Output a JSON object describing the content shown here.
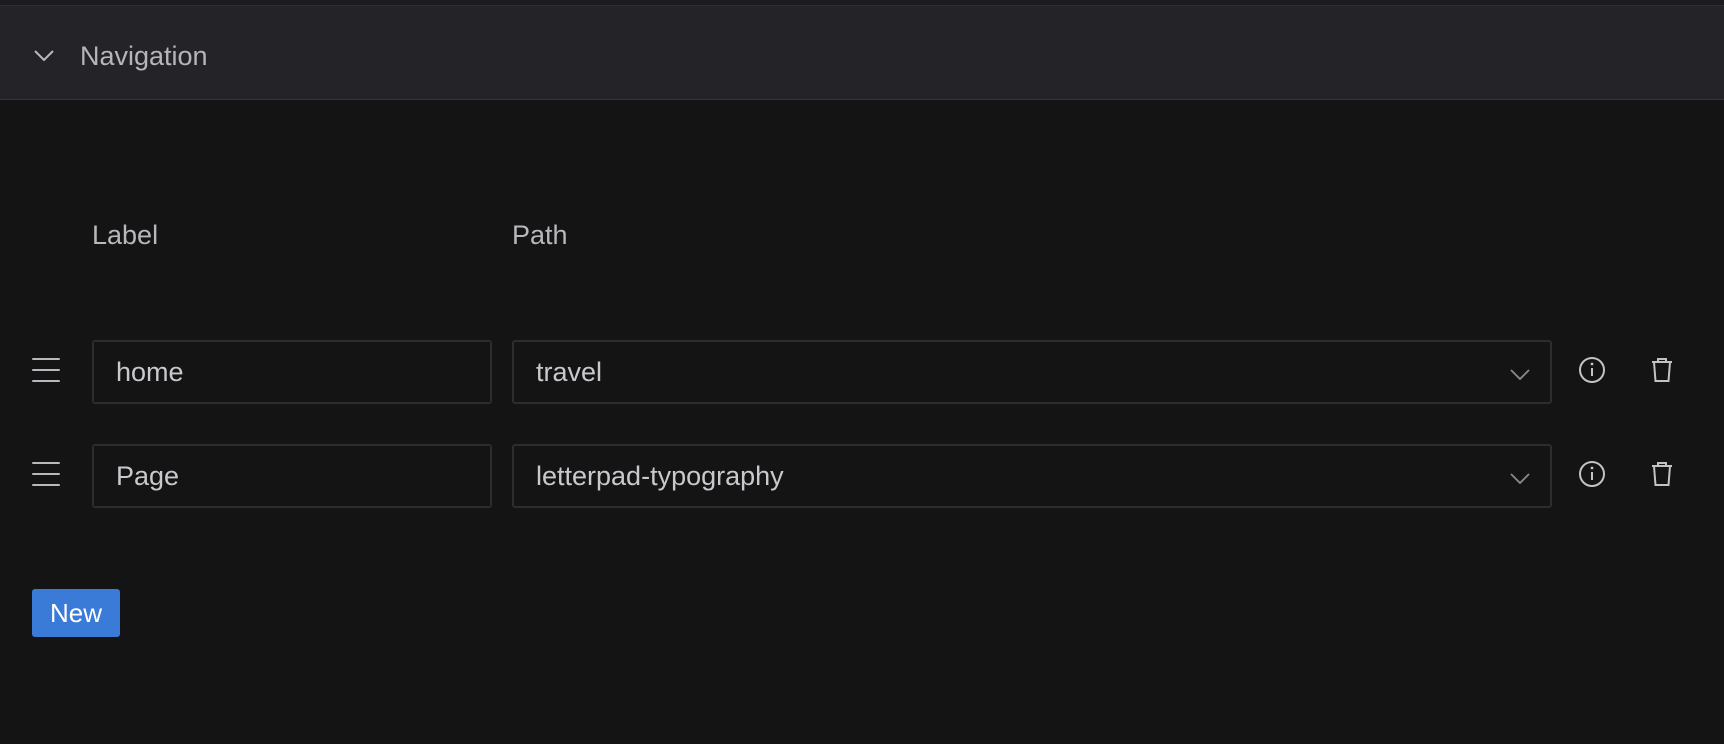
{
  "panel": {
    "title": "Navigation",
    "expanded": true
  },
  "columns": {
    "label": "Label",
    "path": "Path"
  },
  "rows": [
    {
      "label": "home",
      "path": "travel"
    },
    {
      "label": "Page",
      "path": "letterpad-typography"
    }
  ],
  "actions": {
    "new_label": "New"
  },
  "colors": {
    "accent": "#3b7bd8",
    "background": "#141415",
    "header": "#232328"
  },
  "icons": [
    "chevron-down-icon",
    "drag-handle-icon",
    "info-icon",
    "trash-icon"
  ]
}
